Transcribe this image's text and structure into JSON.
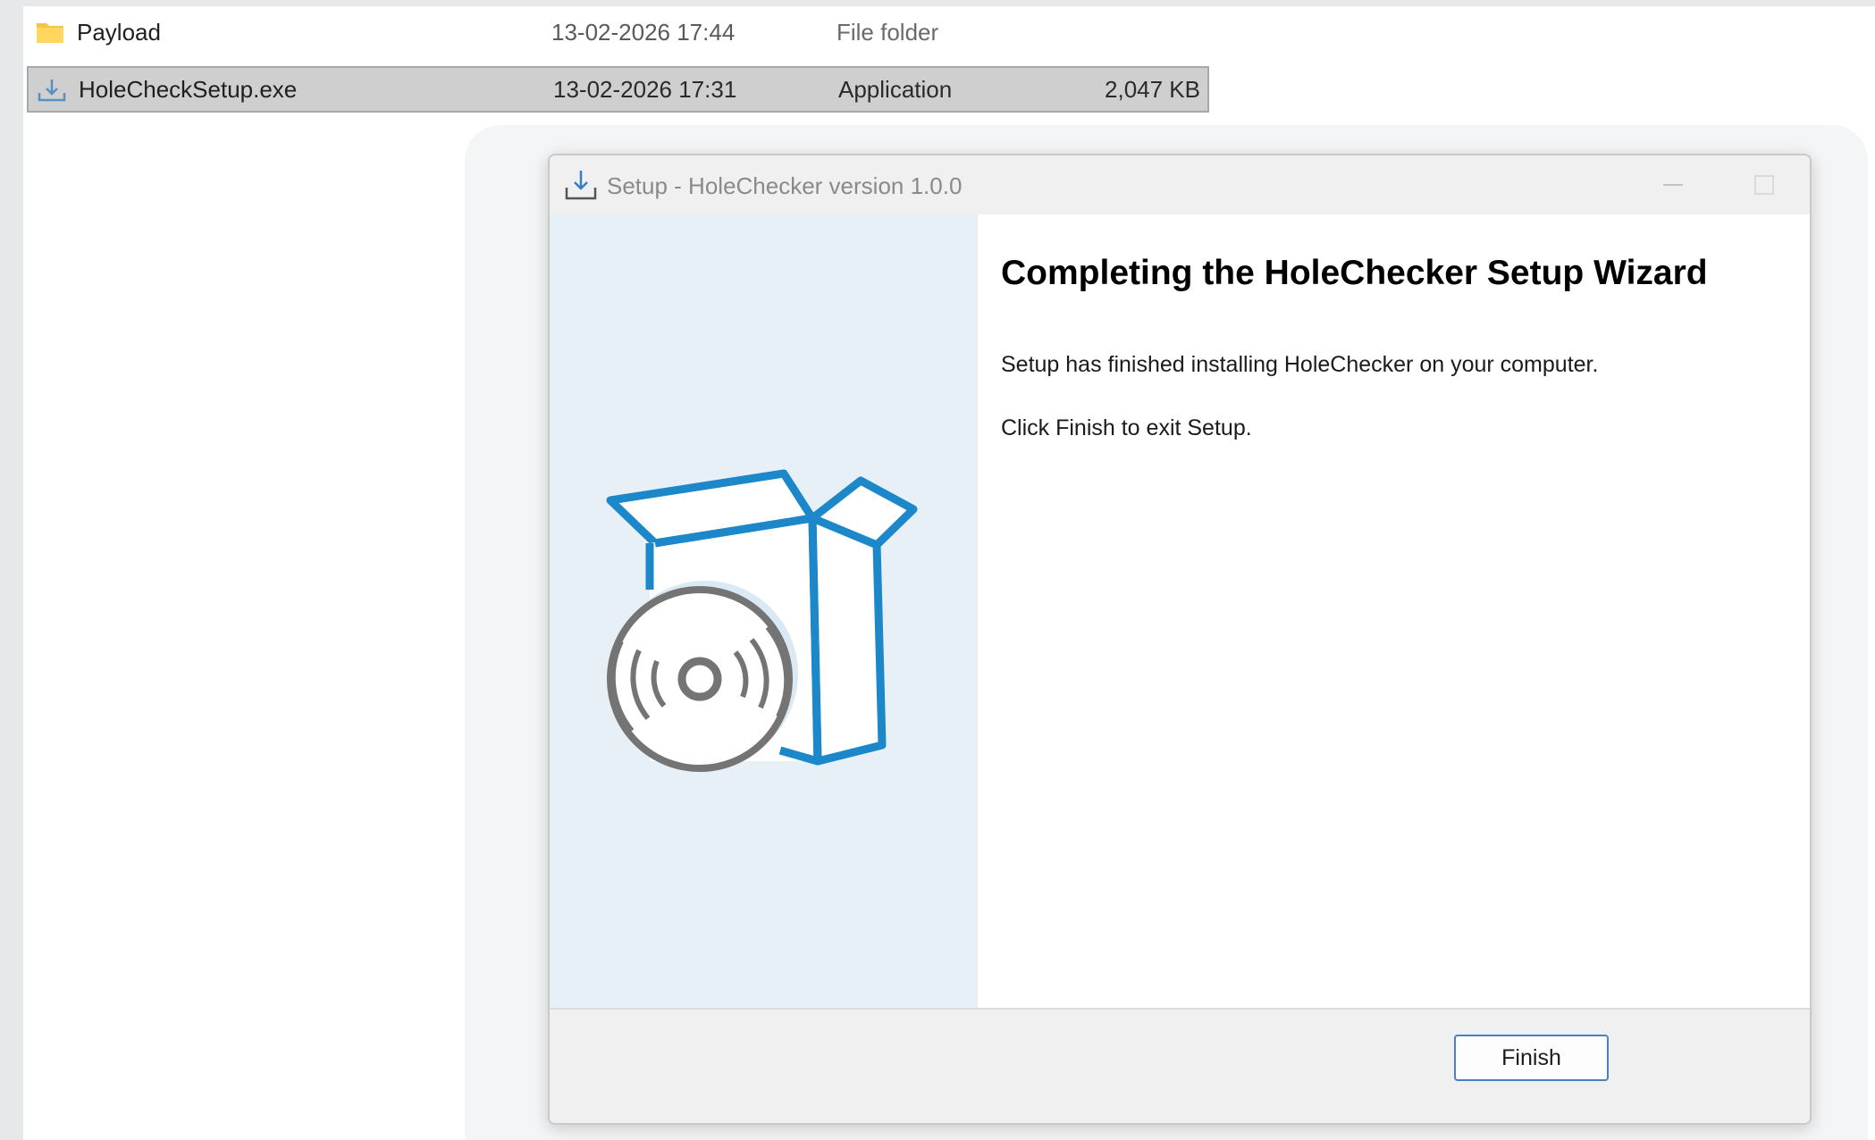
{
  "explorer": {
    "files": [
      {
        "name": "Payload",
        "date": "13-02-2026 17:44",
        "type": "File folder",
        "size": "",
        "icon": "folder-icon"
      },
      {
        "name": "HoleCheckSetup.exe",
        "date": "13-02-2026 17:31",
        "type": "Application",
        "size": "2,047 KB",
        "icon": "installer-icon"
      }
    ]
  },
  "dialog": {
    "title": "Setup - HoleChecker version 1.0.0",
    "heading": "Completing the HoleChecker Setup Wizard",
    "message": "Setup has finished installing HoleChecker on your computer.",
    "instruction": "Click Finish to exit Setup.",
    "finish_label": "Finish",
    "illustration": "box-and-disc-icon"
  },
  "colors": {
    "accent": "#1c87c9",
    "side_panel": "#e7f0f6",
    "selection": "#cfcfcf"
  }
}
